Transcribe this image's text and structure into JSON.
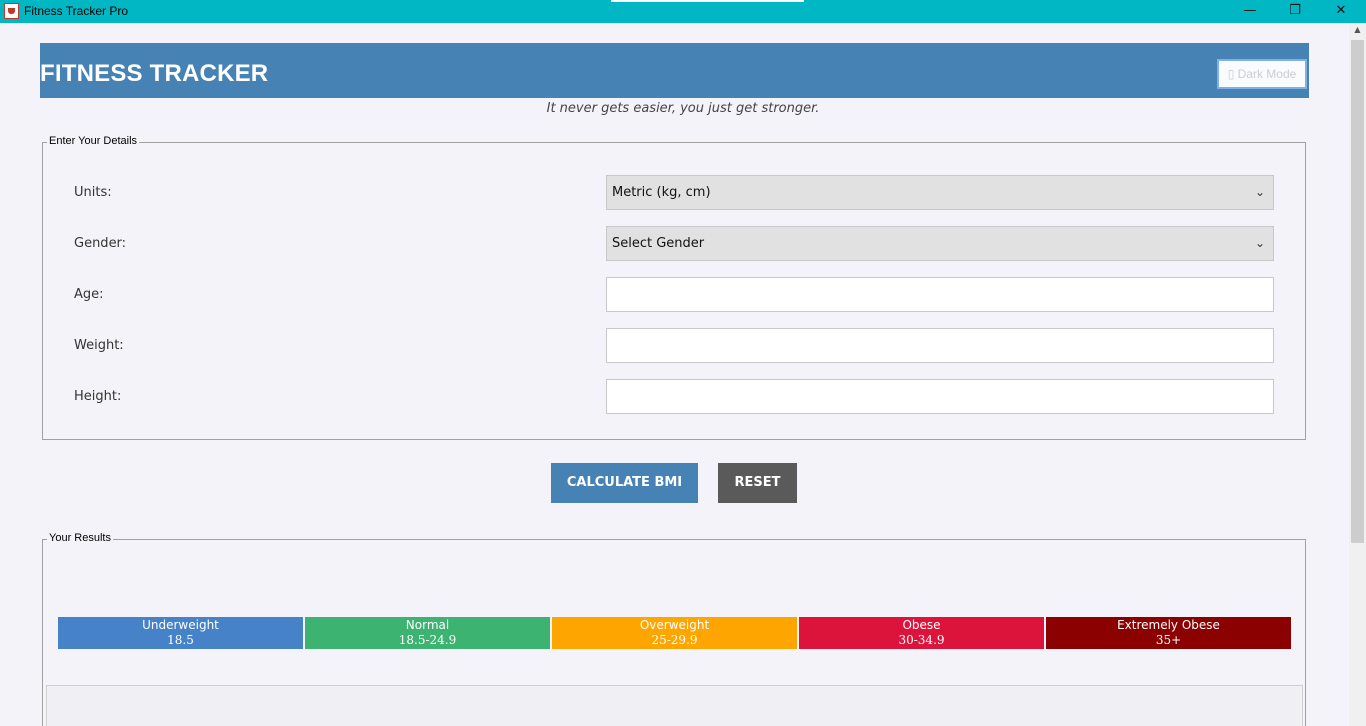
{
  "window": {
    "title": "Fitness Tracker Pro",
    "minimize_icon": "minimize-icon",
    "maximize_icon": "restore-icon",
    "close_icon": "close-icon",
    "minimize_glyph": "—",
    "maximize_glyph": "❐",
    "close_glyph": "✕",
    "titlebar_color": "#00b7c3"
  },
  "header": {
    "title": "FITNESS TRACKER",
    "dark_mode_label": "▯ Dark Mode",
    "background": "#4682b4"
  },
  "quote": "It never gets easier, you just get stronger.",
  "details": {
    "legend": "Enter Your Details",
    "units_label": "Units:",
    "units_value": "Metric (kg, cm)",
    "gender_label": "Gender:",
    "gender_value": "Select Gender",
    "age_label": "Age:",
    "age_value": "",
    "weight_label": "Weight:",
    "weight_value": "",
    "height_label": "Height:",
    "height_value": "",
    "chevron": "⌄"
  },
  "actions": {
    "calculate_label": "CALCULATE BMI",
    "reset_label": "RESET"
  },
  "results": {
    "legend": "Your Results",
    "categories": [
      {
        "name": "Underweight",
        "range": "18.5",
        "color": "#4682c8"
      },
      {
        "name": "Normal",
        "range": "18.5-24.9",
        "color": "#3cb371"
      },
      {
        "name": "Overweight",
        "range": "25-29.9",
        "color": "#ffa500"
      },
      {
        "name": "Obese",
        "range": "30-34.9",
        "color": "#dc143c"
      },
      {
        "name": "Extremely Obese",
        "range": "35+",
        "color": "#8b0000"
      }
    ]
  }
}
